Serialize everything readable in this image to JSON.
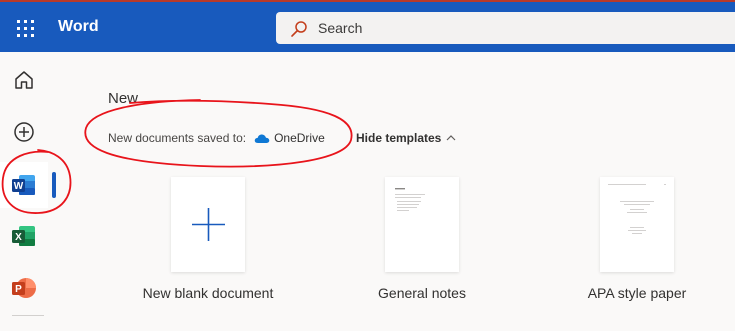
{
  "header": {
    "app_name": "Word",
    "search_placeholder": "Search",
    "background": "#185abd"
  },
  "rail": {
    "items": [
      {
        "name": "home",
        "icon": "home-icon"
      },
      {
        "name": "create",
        "icon": "plus-circle-icon"
      },
      {
        "name": "word",
        "icon": "word-icon",
        "active": true
      },
      {
        "name": "excel",
        "icon": "excel-icon"
      },
      {
        "name": "powerpoint",
        "icon": "powerpoint-icon"
      }
    ]
  },
  "main": {
    "title": "New",
    "save_prefix": "New documents saved to:",
    "save_location": "OneDrive",
    "hide_templates": "Hide templates"
  },
  "templates": [
    {
      "label": "New blank document"
    },
    {
      "label": "General notes"
    },
    {
      "label": "APA style paper"
    }
  ],
  "colors": {
    "accent": "#185abd",
    "annotation": "#e8141b"
  }
}
